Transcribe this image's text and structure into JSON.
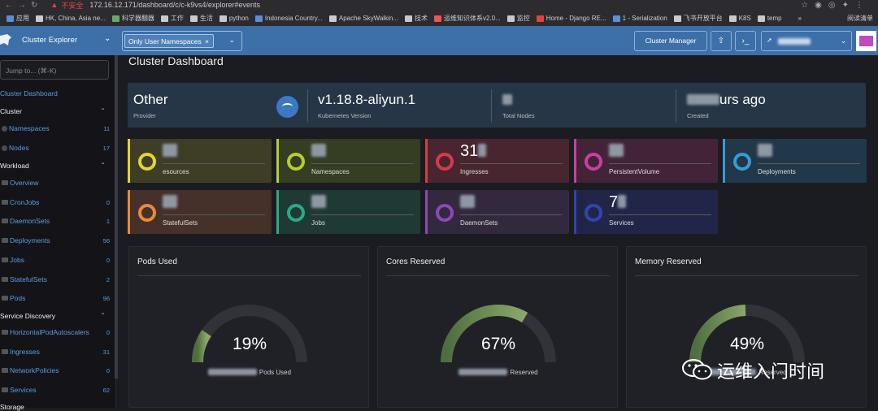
{
  "browser": {
    "insecure_label": "不安全",
    "url": "172.16.12.171/dashboard/c/c-k9vs4/explorer#events",
    "bookmarks": [
      "应用",
      "HK, China, Asia ne...",
      "科学器翻器",
      "工作",
      "生活",
      "python",
      "Indonesia Country...",
      "Apache SkyWalkin...",
      "技术",
      "运维知识体系v2.0...",
      "监控",
      "Home - Django RE...",
      "1 - Serialization",
      "飞书开放平台",
      "K8S",
      "temp"
    ],
    "more": "»",
    "reading_list": "阅读清单"
  },
  "header": {
    "title": "Cluster Explorer",
    "namespace_chip": "Only User Namespaces",
    "cluster_manager": "Cluster Manager",
    "user": "local-admin"
  },
  "sidebar": {
    "search_placeholder": "Jump to... (⌘-K)",
    "dashboard": "Cluster Dashboard",
    "groups": {
      "cluster": "Cluster",
      "workload": "Workload",
      "service_discovery": "Service Discovery",
      "storage": "Storage"
    },
    "cluster_items": [
      {
        "label": "Namespaces",
        "count": "11"
      },
      {
        "label": "Nodes",
        "count": "17"
      }
    ],
    "workload_items": [
      {
        "label": "Overview",
        "count": ""
      },
      {
        "label": "CronJobs",
        "count": "0"
      },
      {
        "label": "DaemonSets",
        "count": "1"
      },
      {
        "label": "Deployments",
        "count": "56"
      },
      {
        "label": "Jobs",
        "count": "0"
      },
      {
        "label": "StatefulSets",
        "count": "2"
      },
      {
        "label": "Pods",
        "count": "96"
      }
    ],
    "sd_items": [
      {
        "label": "HorizontalPodAutoscalers",
        "count": "0"
      },
      {
        "label": "Ingresses",
        "count": "31"
      },
      {
        "label": "NetworkPolicies",
        "count": "0"
      },
      {
        "label": "Services",
        "count": "62"
      }
    ]
  },
  "main": {
    "title": "Cluster Dashboard",
    "info": {
      "provider_value": "Other",
      "provider_label": "Provider",
      "k8s_value": "v1.18.8-aliyun.1",
      "k8s_label": "Kubernetes Version",
      "nodes_label": "Total Nodes",
      "created_value": "urs ago",
      "created_label": "Created"
    },
    "cards": [
      {
        "number": "",
        "label": "esources",
        "color": "#e4d52b",
        "bg": "#3e3d26"
      },
      {
        "number": "",
        "label": "Namespaces",
        "color": "#b7cf2a",
        "bg": "#353d22"
      },
      {
        "number": "31",
        "label": "Ingresses",
        "color": "#d73a4a",
        "bg": "#492530"
      },
      {
        "number": "",
        "label": "PersistentVolume",
        "color": "#cb3fa0",
        "bg": "#432337"
      },
      {
        "number": "",
        "label": "Deployments",
        "color": "#3a9bd4",
        "bg": "#21384a"
      },
      {
        "number": "",
        "label": "StatefulSets",
        "color": "#e88a3e",
        "bg": "#46302a"
      },
      {
        "number": "",
        "label": "Jobs",
        "color": "#2aa988",
        "bg": "#1f3a35"
      },
      {
        "number": "",
        "label": "DaemonSets",
        "color": "#8a4ab4",
        "bg": "#33293f"
      },
      {
        "number": "7",
        "label": "Services",
        "color": "#3344b0",
        "bg": "#212649"
      }
    ],
    "panels": [
      {
        "title": "Pods Used",
        "percent": "19%",
        "fraction": 0.19,
        "sub_fragment": "Pods Used"
      },
      {
        "title": "Cores Reserved",
        "percent": "67%",
        "fraction": 0.67,
        "sub_fragment": "Reserved"
      },
      {
        "title": "Memory Reserved",
        "percent": "49%",
        "fraction": 0.49,
        "sub_fragment": "Reserved"
      }
    ]
  },
  "watermark": {
    "text": "运维入门时间"
  },
  "colors": {
    "header": "#3d6fa8",
    "link": "#5c9ce0",
    "gauge_fill": "#8aa86a",
    "gauge_track": "#323338"
  }
}
